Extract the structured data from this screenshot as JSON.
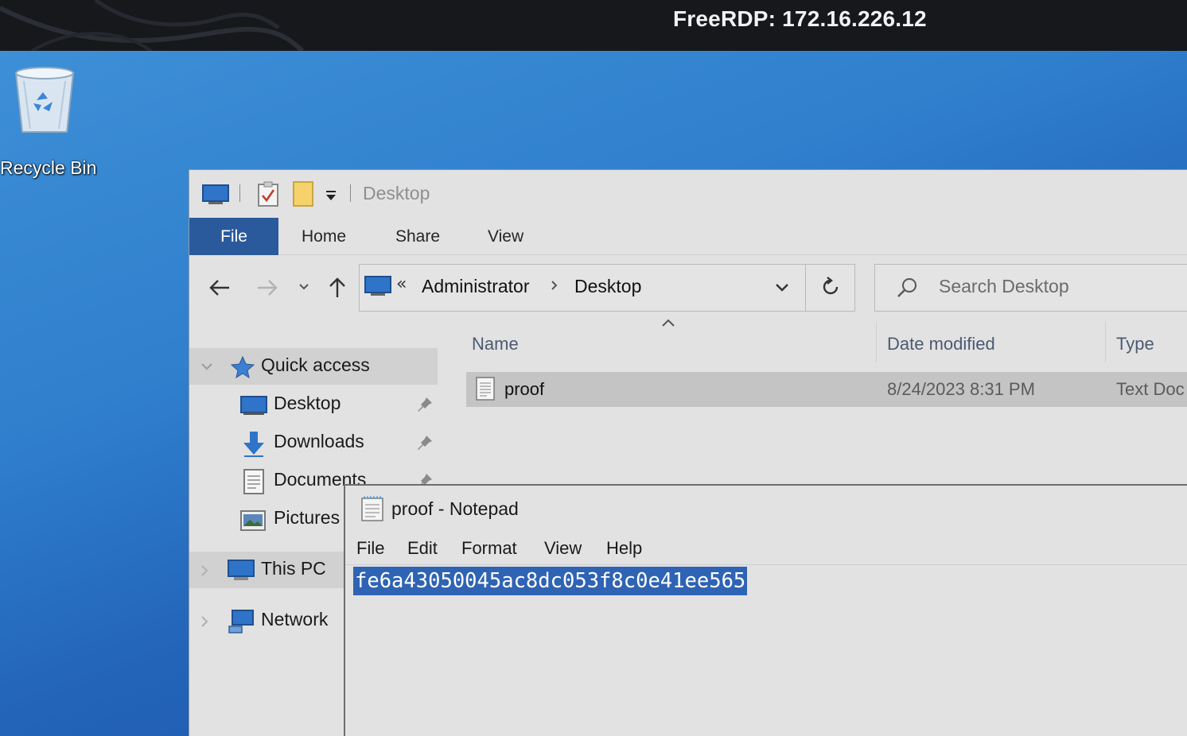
{
  "rdp": {
    "title": "FreeRDP: 172.16.226.12"
  },
  "desktop": {
    "icons": [
      {
        "label": "Recycle Bin",
        "icon": "recycle-bin-icon"
      }
    ]
  },
  "explorer": {
    "qat_title": "Desktop",
    "ribbon_tabs": [
      "File",
      "Home",
      "Share",
      "View"
    ],
    "address": {
      "crumbs": [
        "Administrator",
        "Desktop"
      ]
    },
    "search": {
      "placeholder": "Search Desktop"
    },
    "navpane": {
      "quick_access": "Quick access",
      "items": [
        "Desktop",
        "Downloads",
        "Documents",
        "Pictures"
      ],
      "this_pc": "This PC",
      "network": "Network"
    },
    "columns": [
      "Name",
      "Date modified",
      "Type"
    ],
    "rows": [
      {
        "name": "proof",
        "date_modified": "8/24/2023 8:31 PM",
        "type": "Text Doc"
      }
    ]
  },
  "notepad": {
    "title": "proof - Notepad",
    "menu": [
      "File",
      "Edit",
      "Format",
      "View",
      "Help"
    ],
    "content": "fe6a43050045ac8dc053f8c0e41ee565"
  },
  "colors": {
    "desktop_bg": "#2f7fcd",
    "ribbon_file_tab": "#2a5a9c",
    "selection": "#2f63b3",
    "selected_row": "#c4c4c4"
  }
}
